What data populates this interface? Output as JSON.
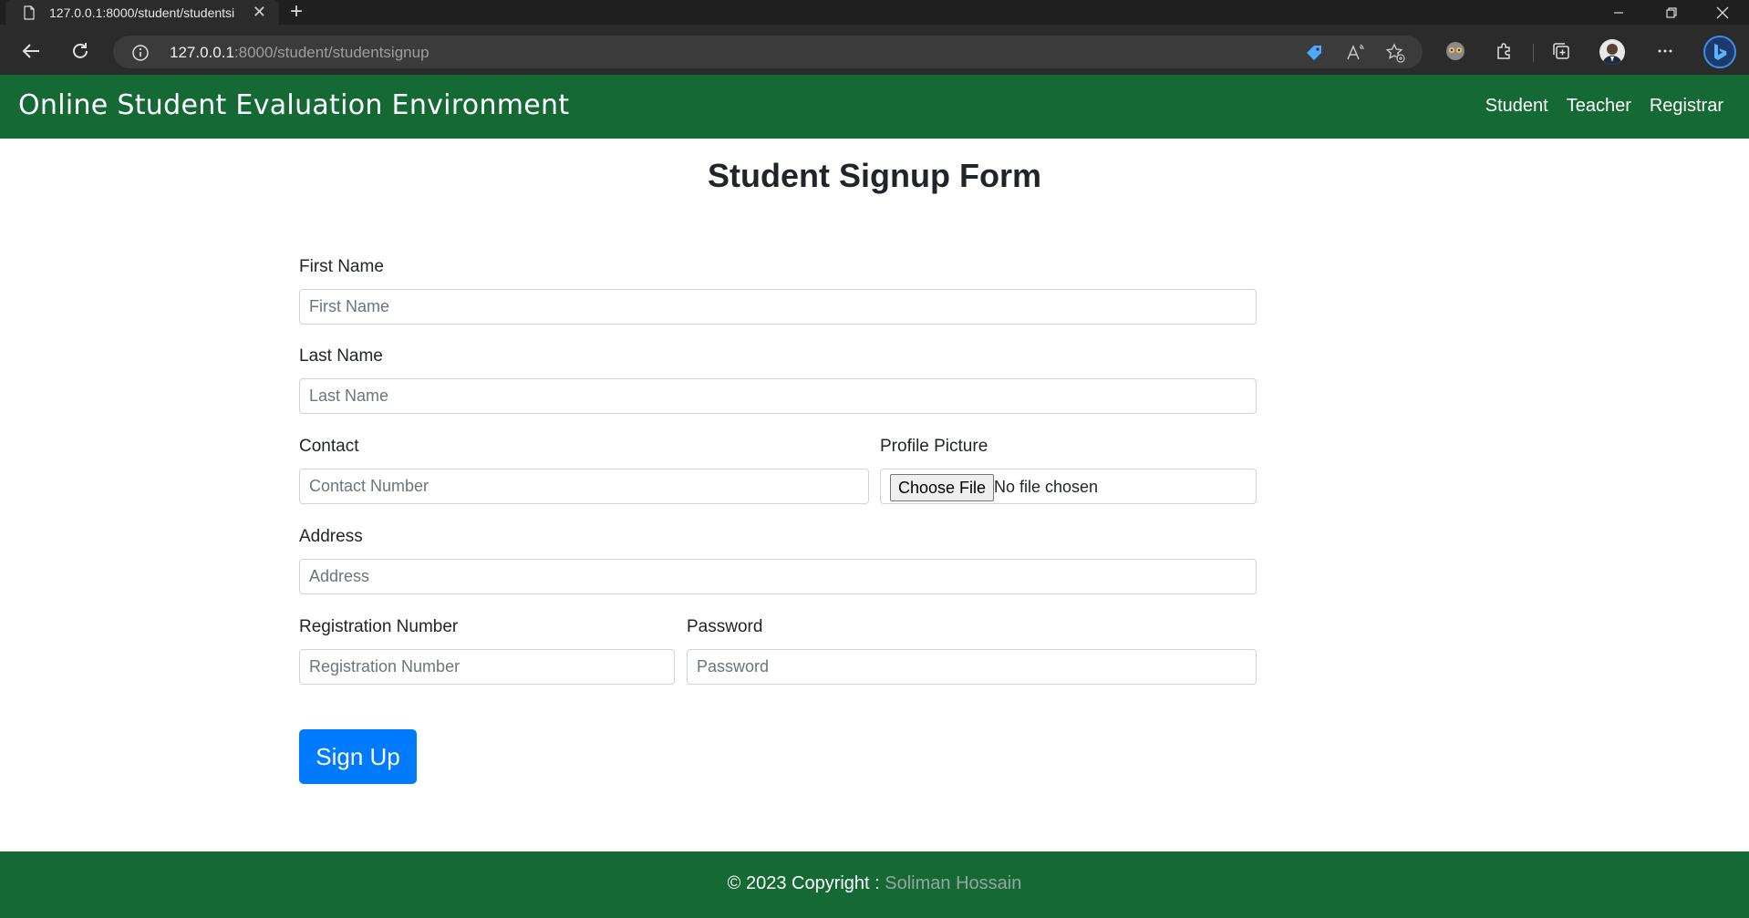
{
  "browser": {
    "tab_title": "127.0.0.1:8000/student/studentsi",
    "url_host": "127.0.0.1",
    "url_path": ":8000/student/studentsignup",
    "new_tab_glyph": "+",
    "close_glyph": "✕"
  },
  "navbar": {
    "brand": "Online Student Evaluation Environment",
    "links": [
      "Student",
      "Teacher",
      "Registrar"
    ],
    "bg_color": "#146934"
  },
  "form": {
    "title": "Student Signup Form",
    "first_name": {
      "label": "First Name",
      "placeholder": "First Name"
    },
    "last_name": {
      "label": "Last Name",
      "placeholder": "Last Name"
    },
    "contact": {
      "label": "Contact",
      "placeholder": "Contact Number"
    },
    "profile_picture": {
      "label": "Profile Picture",
      "button": "Choose File",
      "status": "No file chosen"
    },
    "address": {
      "label": "Address",
      "placeholder": "Address"
    },
    "registration": {
      "label": "Registration Number",
      "placeholder": "Registration Number"
    },
    "password": {
      "label": "Password",
      "placeholder": "Password"
    },
    "submit": "Sign Up",
    "submit_color": "#007bff"
  },
  "footer": {
    "prefix": "© 2023 Copyright : ",
    "author": "Soliman Hossain"
  }
}
